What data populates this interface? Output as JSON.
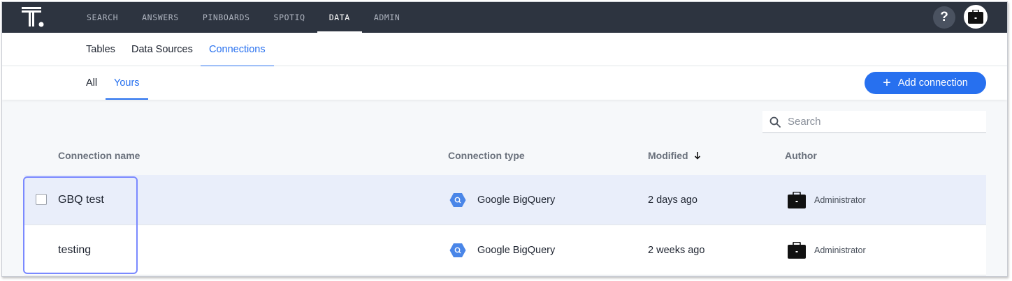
{
  "topnav": {
    "items": [
      {
        "label": "SEARCH"
      },
      {
        "label": "ANSWERS"
      },
      {
        "label": "PINBOARDS"
      },
      {
        "label": "SPOTIQ"
      },
      {
        "label": "DATA"
      },
      {
        "label": "ADMIN"
      }
    ],
    "active": "DATA",
    "help_label": "?"
  },
  "subnav": {
    "tabs": [
      "Tables",
      "Data Sources",
      "Connections"
    ],
    "active": "Connections"
  },
  "filter": {
    "tabs": [
      "All",
      "Yours"
    ],
    "active": "Yours",
    "add_button_label": "Add connection"
  },
  "search": {
    "placeholder": "Search",
    "value": ""
  },
  "table": {
    "columns": [
      "Connection name",
      "Connection type",
      "Modified",
      "Author"
    ],
    "sorted_column": "Modified",
    "rows": [
      {
        "name": "GBQ test",
        "type": "Google BigQuery",
        "modified": "2 days ago",
        "author": "Administrator",
        "selected": true
      },
      {
        "name": "testing",
        "type": "Google BigQuery",
        "modified": "2 weeks ago",
        "author": "Administrator",
        "selected": false
      }
    ]
  },
  "colors": {
    "nav_bg": "#2d3440",
    "accent": "#2770ef",
    "row_selected": "#e9eefa",
    "highlight": "#7a89ff"
  },
  "icons": {
    "logo": "thoughtspot-logo",
    "connection_type": "bigquery-hexagon-icon",
    "author": "briefcase-icon",
    "search": "search-icon",
    "sort": "arrow-down-icon"
  }
}
